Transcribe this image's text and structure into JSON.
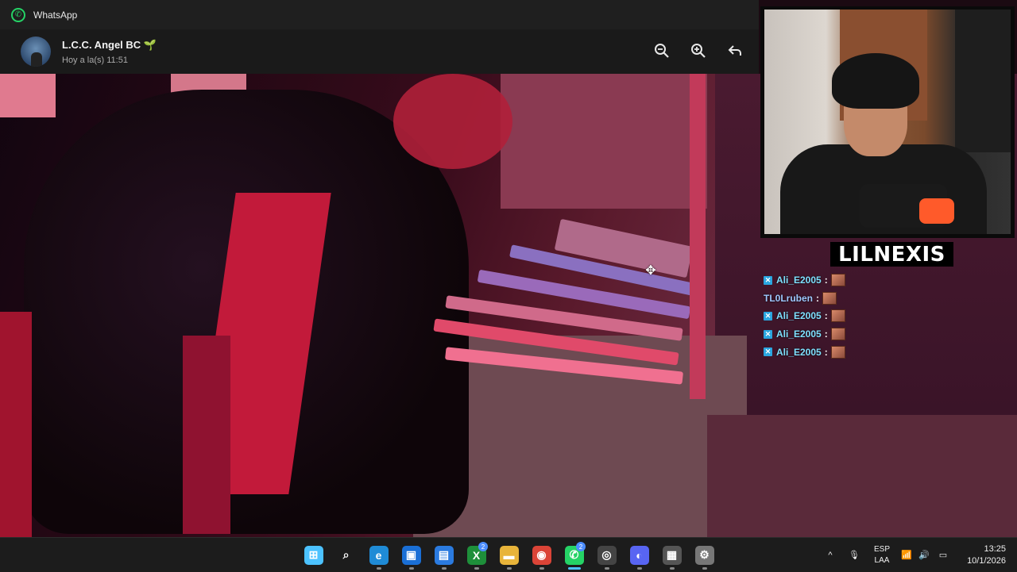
{
  "window": {
    "app_title": "WhatsApp"
  },
  "viewer": {
    "contact_name": "L.C.C. Angel BC 🌱",
    "timestamp": "Hoy a la(s) 11:51",
    "actions": [
      {
        "icon": "zoom-out-icon",
        "glyph": "−"
      },
      {
        "icon": "zoom-in-icon",
        "glyph": "+"
      },
      {
        "icon": "reply-icon",
        "glyph": "↩"
      }
    ]
  },
  "stream": {
    "streamer_name": "LILNEXIS",
    "chat": [
      {
        "user": "Ali_E2005",
        "badge": true
      },
      {
        "user": "TL0Lruben",
        "badge": false
      },
      {
        "user": "Ali_E2005",
        "badge": true
      },
      {
        "user": "Ali_E2005",
        "badge": true
      },
      {
        "user": "Ali_E2005",
        "badge": true
      }
    ]
  },
  "taskbar": {
    "apps": [
      {
        "name": "start-button",
        "label": "⊞",
        "color": "#4cc2ff"
      },
      {
        "name": "search-button",
        "label": "⌕",
        "color": "transparent"
      },
      {
        "name": "edge-app",
        "label": "e",
        "color": "#1f8bd6"
      },
      {
        "name": "store-app",
        "label": "▣",
        "color": "#1a6fd6"
      },
      {
        "name": "notes-app",
        "label": "▤",
        "color": "#2b7be0"
      },
      {
        "name": "xbox-app",
        "label": "X",
        "color": "#1e8f3a",
        "badge": "2"
      },
      {
        "name": "file-explorer-app",
        "label": "▬",
        "color": "#e8b43a"
      },
      {
        "name": "chrome-app",
        "label": "◉",
        "color": "#db4437"
      },
      {
        "name": "whatsapp-app",
        "label": "✆",
        "color": "#25d366",
        "badge": "2",
        "active": true
      },
      {
        "name": "obs-app",
        "label": "◎",
        "color": "#444"
      },
      {
        "name": "discord-app",
        "label": "◐",
        "color": "#5865f2"
      },
      {
        "name": "tools-app",
        "label": "▦",
        "color": "#555"
      },
      {
        "name": "settings-app",
        "label": "⚙",
        "color": "#777"
      }
    ],
    "tray": {
      "chevron": "^",
      "mic": "🎙",
      "lang_top": "ESP",
      "lang_bottom": "LAA",
      "wifi": "📶",
      "volume": "🔊",
      "battery": "▭",
      "time": "13:25",
      "date": "10/1/2026"
    }
  }
}
